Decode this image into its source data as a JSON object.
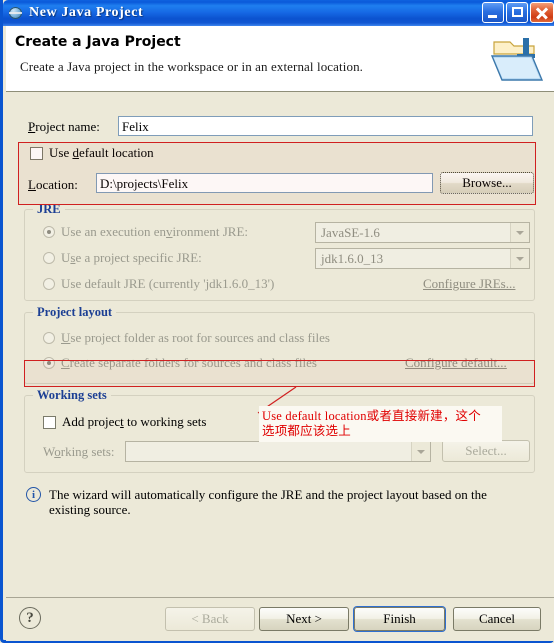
{
  "window": {
    "title": "New Java Project",
    "icon": "eclipse-globe-icon",
    "buttons": {
      "minimize": "Minimize",
      "maximize": "Maximize",
      "close": "Close"
    }
  },
  "banner": {
    "title": "Create a Java Project",
    "subtitle": "Create a Java project in the workspace or in an external location.",
    "icon": "java-project-folder-icon"
  },
  "project_name": {
    "label": "Project name:",
    "value": "Felix",
    "placeholder": ""
  },
  "location": {
    "use_default_checkbox": {
      "label": "Use default location",
      "checked": false
    },
    "label": "Location:",
    "value": "D:\\projects\\Felix",
    "browse_button": "Browse..."
  },
  "jre": {
    "caption": "JRE",
    "options": [
      {
        "label": "Use an execution environment JRE:",
        "selected": true,
        "combo_value": "JavaSE-1.6"
      },
      {
        "label": "Use a project specific JRE:",
        "selected": false,
        "combo_value": "jdk1.6.0_13"
      },
      {
        "label": "Use default JRE (currently 'jdk1.6.0_13')",
        "selected": false,
        "combo_value": ""
      }
    ],
    "configure_link": "Configure JREs..."
  },
  "project_layout": {
    "caption": "Project layout",
    "options": [
      {
        "label": "Use project folder as root for sources and class files",
        "selected": false
      },
      {
        "label": "Create separate folders for sources and class files",
        "selected": true
      }
    ],
    "configure_link": "Configure default..."
  },
  "working_sets": {
    "caption": "Working sets",
    "add_checkbox": {
      "label": "Add project to working sets",
      "checked": false
    },
    "label": "Working sets:",
    "combo_value": "",
    "select_button": "Select..."
  },
  "info_message": {
    "icon": "info-icon",
    "text": "The wizard will automatically configure the JRE and the project layout based on the existing source."
  },
  "footer": {
    "help": "?",
    "back": "< Back",
    "next": "Next >",
    "finish": "Finish",
    "cancel": "Cancel"
  },
  "annotation": {
    "text": "Use default location或者直接新建，这个\n选项都应该选上",
    "color": "#e00000"
  }
}
